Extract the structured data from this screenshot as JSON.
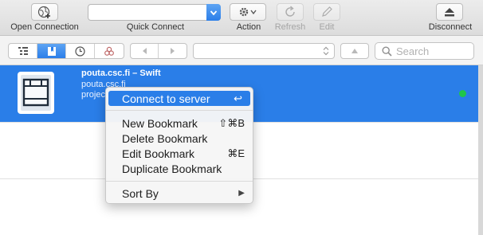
{
  "toolbar": {
    "open_connection": "Open Connection",
    "quick_connect": "Quick Connect",
    "action": "Action",
    "refresh": "Refresh",
    "edit": "Edit",
    "disconnect": "Disconnect"
  },
  "search": {
    "placeholder": "Search"
  },
  "bookmark": {
    "title": "pouta.csc.fi – Swift",
    "host": "pouta.csc.fi",
    "project": "project",
    "status": "connected"
  },
  "context_menu": {
    "connect": "Connect to server",
    "connect_shortcut": "↩",
    "new_bookmark": "New Bookmark",
    "new_bookmark_shortcut": "⇧⌘B",
    "delete_bookmark": "Delete Bookmark",
    "edit_bookmark": "Edit Bookmark",
    "edit_bookmark_shortcut": "⌘E",
    "duplicate_bookmark": "Duplicate Bookmark",
    "sort_by": "Sort By",
    "submenu_arrow": "▶"
  },
  "colors": {
    "accent": "#2a7ee8",
    "status_online": "#1fc64a"
  }
}
